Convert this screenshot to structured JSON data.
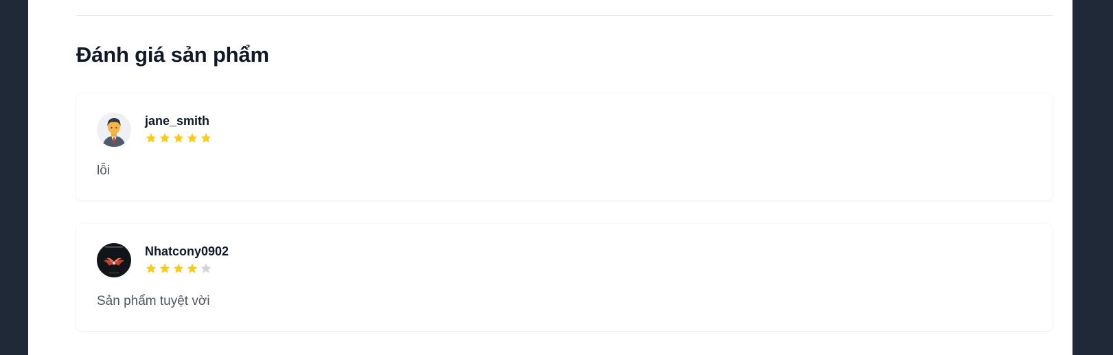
{
  "section": {
    "title": "Đánh giá sản phẩm"
  },
  "reviews": [
    {
      "username": "jane_smith",
      "rating": 5,
      "max_rating": 5,
      "comment": "lỗi",
      "avatar_icon": "businessman-avatar-icon"
    },
    {
      "username": "Nhatcony0902",
      "rating": 4,
      "max_rating": 5,
      "comment": "Sản phẩm tuyệt vời",
      "avatar_icon": "dark-wings-avatar-icon"
    }
  ],
  "colors": {
    "star_filled": "#facc15",
    "star_empty": "#d1d5db",
    "background_frame": "#1f2937",
    "page": "#ffffff",
    "title_text": "#111827",
    "comment_text": "#4b5563"
  }
}
